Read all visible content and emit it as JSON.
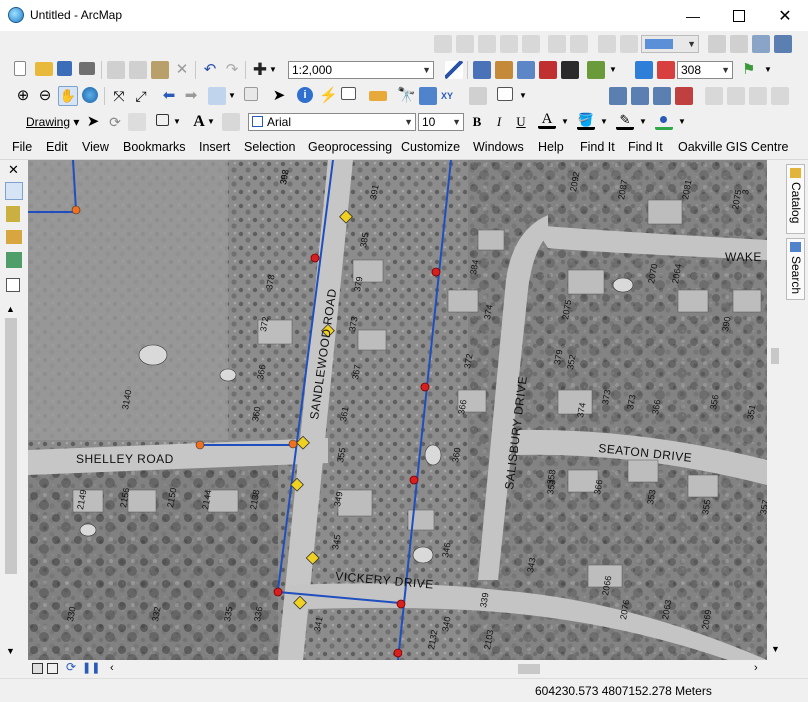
{
  "window": {
    "title": "Untitled - ArcMap"
  },
  "toolbar": {
    "scale": "1:2,000",
    "zoom_percent": "308",
    "drawing_label": "Drawing",
    "font_name": "Arial",
    "font_size": "10",
    "bold": "B",
    "italic": "I",
    "underline": "U",
    "text_tool": "A"
  },
  "menu": [
    "File",
    "Edit",
    "View",
    "Bookmarks",
    "Insert",
    "Selection",
    "Geoprocessing",
    "Customize",
    "Windows",
    "Help",
    "Find It",
    "Find It",
    "Oakville GIS Centre"
  ],
  "side_tabs": {
    "catalog": "Catalog",
    "search": "Search"
  },
  "map": {
    "roads": [
      "SANDLEWOOD ROAD",
      "SHELLEY ROAD",
      "SALISBURY DRIVE",
      "SEATON DRIVE",
      "VICKERY DRIVE",
      "WAKE"
    ],
    "house_numbers": [
      "392",
      "391",
      "385",
      "384",
      "378",
      "379",
      "374",
      "372",
      "373",
      "372",
      "366",
      "367",
      "366",
      "360",
      "361",
      "360",
      "355",
      "349",
      "353",
      "345",
      "346",
      "343",
      "340",
      "341",
      "339",
      "336",
      "335",
      "332",
      "330",
      "3140",
      "2149",
      "2156",
      "2150",
      "2144",
      "2138",
      "2132",
      "2103",
      "2092",
      "2087",
      "2081",
      "2075",
      "2069",
      "2064",
      "2070",
      "2076",
      "2063",
      "2066",
      "2075",
      "379",
      "373",
      "373",
      "366",
      "356",
      "358",
      "366",
      "353",
      "355",
      "357",
      "3",
      "390",
      "374",
      "352",
      "351",
      "308"
    ]
  },
  "status": {
    "coordinates": "604230.573  4807152.278 Meters"
  },
  "colors": {
    "water_line": "#1f4fbf",
    "valve": "#d62020",
    "hydrant": "#f0d020",
    "accent": "#2a6edc"
  }
}
